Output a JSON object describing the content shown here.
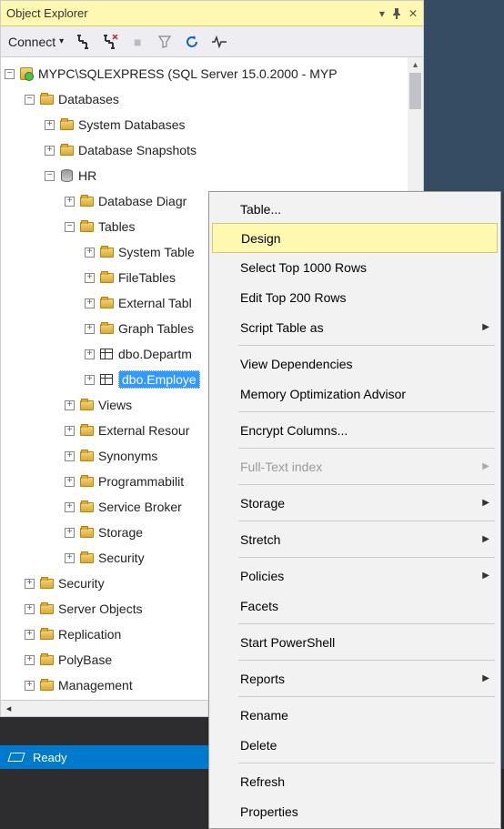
{
  "panel_title": "Object Explorer",
  "toolbar": {
    "connect": "Connect"
  },
  "tree": {
    "server": "MYPC\\SQLEXPRESS (SQL Server 15.0.2000 - MYP",
    "databases": "Databases",
    "system_databases": "System Databases",
    "database_snapshots": "Database Snapshots",
    "hr": "HR",
    "database_diagrams": "Database Diagr",
    "tables": "Tables",
    "system_tables": "System Table",
    "filetables": "FileTables",
    "external_tables": "External Tabl",
    "graph_tables": "Graph Tables",
    "dbo_department": "dbo.Departm",
    "dbo_employee": "dbo.Employe",
    "views": "Views",
    "external_resources": "External Resour",
    "synonyms": "Synonyms",
    "programmability": "Programmabilit",
    "service_broker": "Service Broker",
    "storage": "Storage",
    "hr_security": "Security",
    "security": "Security",
    "server_objects": "Server Objects",
    "replication": "Replication",
    "polybase": "PolyBase",
    "management": "Management"
  },
  "menu": {
    "table": "Table...",
    "design": "Design",
    "select_top": "Select Top 1000 Rows",
    "edit_top": "Edit Top 200 Rows",
    "script_as": "Script Table as",
    "view_deps": "View Dependencies",
    "mem_opt": "Memory Optimization Advisor",
    "encrypt": "Encrypt Columns...",
    "fulltext": "Full-Text index",
    "storage": "Storage",
    "stretch": "Stretch",
    "policies": "Policies",
    "facets": "Facets",
    "powershell": "Start PowerShell",
    "reports": "Reports",
    "rename": "Rename",
    "delete": "Delete",
    "refresh": "Refresh",
    "properties": "Properties"
  },
  "status": {
    "ready": "Ready"
  }
}
